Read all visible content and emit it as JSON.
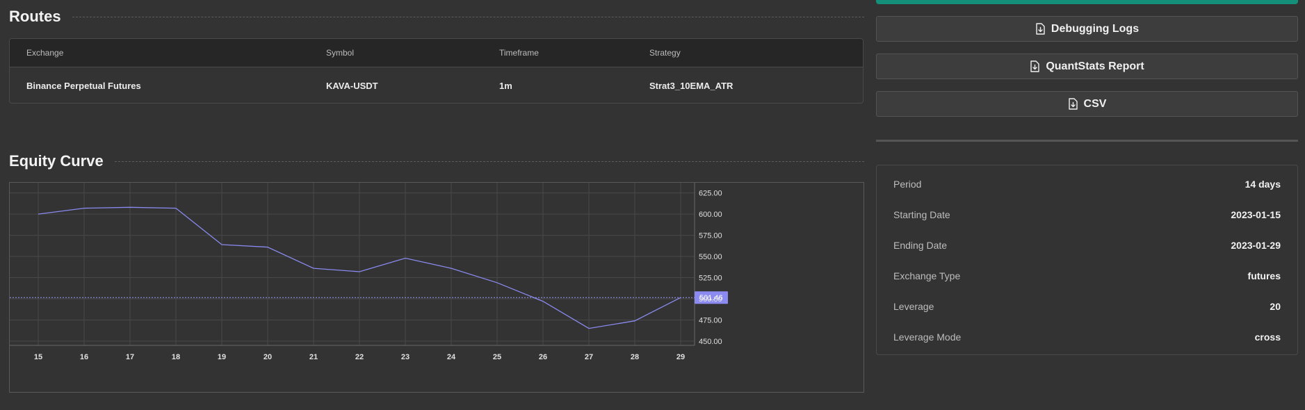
{
  "routes": {
    "title": "Routes",
    "columns": [
      "Exchange",
      "Symbol",
      "Timeframe",
      "Strategy"
    ],
    "rows": [
      {
        "exchange": "Binance Perpetual Futures",
        "symbol": "KAVA-USDT",
        "timeframe": "1m",
        "strategy": "Strat3_10EMA_ATR"
      }
    ]
  },
  "equity": {
    "title": "Equity Curve"
  },
  "buttons": {
    "debug": "Debugging Logs",
    "quantstats": "QuantStats Report",
    "csv": "CSV",
    "icon": "file-download-icon",
    "accent_color": "#138f7a"
  },
  "info": [
    {
      "label": "Period",
      "value": "14 days"
    },
    {
      "label": "Starting Date",
      "value": "2023-01-15"
    },
    {
      "label": "Ending Date",
      "value": "2023-01-29"
    },
    {
      "label": "Exchange Type",
      "value": "futures"
    },
    {
      "label": "Leverage",
      "value": "20"
    },
    {
      "label": "Leverage Mode",
      "value": "cross"
    }
  ],
  "chart_data": {
    "type": "line",
    "x": [
      "15",
      "16",
      "17",
      "18",
      "19",
      "20",
      "21",
      "22",
      "23",
      "24",
      "25",
      "26",
      "27",
      "28",
      "29"
    ],
    "series": [
      {
        "values": [
          600,
          607,
          608,
          607,
          564,
          561,
          536,
          532,
          548,
          536,
          519,
          497,
          465,
          474,
          501.46
        ]
      }
    ],
    "ylim": [
      445,
      637
    ],
    "yticks": [
      "625.00",
      "600.00",
      "575.00",
      "550.00",
      "525.00",
      "500.00",
      "475.00",
      "450.00"
    ],
    "last_value": 501.46,
    "last_value_label": "501.46",
    "line_color": "#8a8af0",
    "grid": true
  }
}
